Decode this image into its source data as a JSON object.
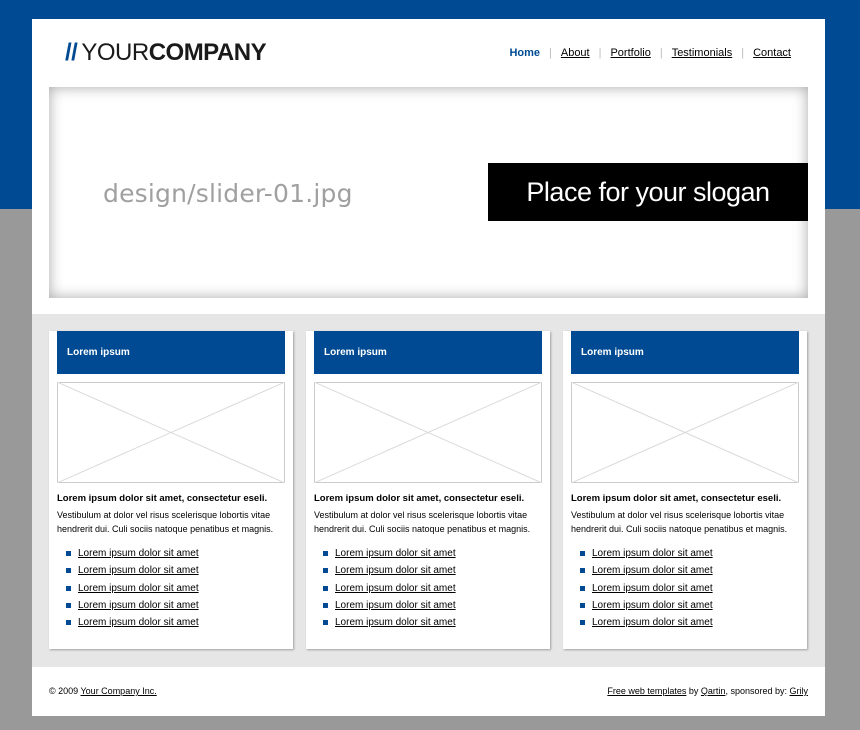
{
  "header": {
    "logo": {
      "slashes": "//",
      "light": "YOUR",
      "bold": "COMPANY"
    },
    "nav": [
      "Home",
      "About",
      "Portfolio",
      "Testimonials",
      "Contact"
    ],
    "nav_separator": "|",
    "active": "Home"
  },
  "slider": {
    "file_label": "design/slider-01.jpg",
    "slogan": "Place for your slogan"
  },
  "columns": [
    {
      "heading": "Lorem ipsum",
      "title": "Lorem ipsum dolor sit amet, consectetur eseli.",
      "text": "Vestibulum at dolor vel risus scelerisque lobortis vitae hendrerit dui. Culi sociis natoque penatibus et magnis.",
      "links": [
        "Lorem ipsum dolor sit amet",
        "Lorem ipsum dolor sit amet",
        "Lorem ipsum dolor sit amet",
        "Lorem ipsum dolor sit amet",
        "Lorem ipsum dolor sit amet"
      ]
    },
    {
      "heading": "Lorem ipsum",
      "title": "Lorem ipsum dolor sit amet, consectetur eseli.",
      "text": "Vestibulum at dolor vel risus scelerisque lobortis vitae hendrerit dui. Culi sociis natoque penatibus et magnis.",
      "links": [
        "Lorem ipsum dolor sit amet",
        "Lorem ipsum dolor sit amet",
        "Lorem ipsum dolor sit amet",
        "Lorem ipsum dolor sit amet",
        "Lorem ipsum dolor sit amet"
      ]
    },
    {
      "heading": "Lorem ipsum",
      "title": "Lorem ipsum dolor sit amet, consectetur eseli.",
      "text": "Vestibulum at dolor vel risus scelerisque lobortis vitae hendrerit dui. Culi sociis natoque penatibus et magnis.",
      "links": [
        "Lorem ipsum dolor sit amet",
        "Lorem ipsum dolor sit amet",
        "Lorem ipsum dolor sit amet",
        "Lorem ipsum dolor sit amet",
        "Lorem ipsum dolor sit amet"
      ]
    }
  ],
  "footer": {
    "copyright": "© 2009",
    "company_link": "Your Company Inc.",
    "templates_link": "Free web templates",
    "by": "by",
    "author_link": "Qartin",
    "sponsored": ", sponsored by:",
    "sponsor_link": "Grily"
  },
  "colors": {
    "brand_blue": "#004a93",
    "background_gray": "#999999",
    "content_gray": "#e6e6e6"
  }
}
